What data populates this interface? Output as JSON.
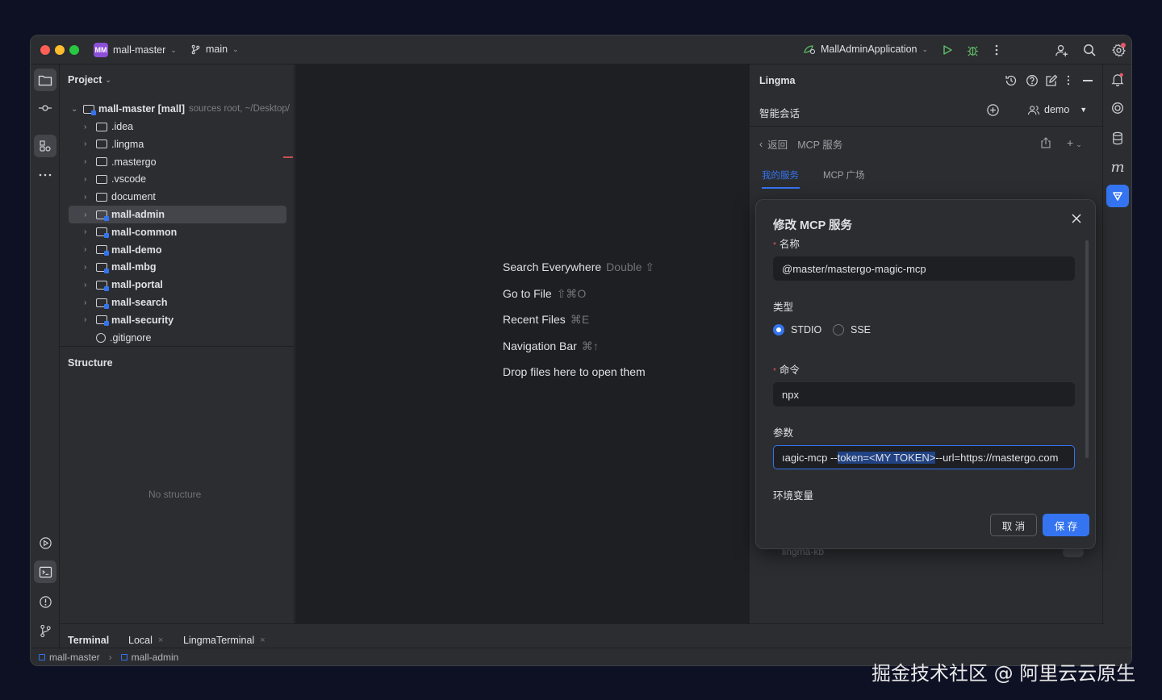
{
  "titlebar": {
    "project_badge": "MM",
    "project_name": "mall-master",
    "branch": "main",
    "run_config": "MallAdminApplication"
  },
  "project_panel": {
    "title": "Project",
    "root": {
      "name": "mall-master [mall]",
      "note": "sources root, ~/Desktop/"
    },
    "items": [
      {
        "label": ".idea",
        "bold": false
      },
      {
        "label": ".lingma",
        "bold": false
      },
      {
        "label": ".mastergo",
        "bold": false
      },
      {
        "label": ".vscode",
        "bold": false
      },
      {
        "label": "document",
        "bold": false
      },
      {
        "label": "mall-admin",
        "bold": true
      },
      {
        "label": "mall-common",
        "bold": true
      },
      {
        "label": "mall-demo",
        "bold": true
      },
      {
        "label": "mall-mbg",
        "bold": true
      },
      {
        "label": "mall-portal",
        "bold": true
      },
      {
        "label": "mall-search",
        "bold": true
      },
      {
        "label": "mall-security",
        "bold": true
      },
      {
        "label": ".gitignore",
        "bold": false
      }
    ]
  },
  "structure_panel": {
    "title": "Structure",
    "empty": "No structure"
  },
  "editor_hints": [
    {
      "label": "Search Everywhere",
      "key": "Double ⇧"
    },
    {
      "label": "Go to File",
      "key": "⇧⌘O"
    },
    {
      "label": "Recent Files",
      "key": "⌘E"
    },
    {
      "label": "Navigation Bar",
      "key": "⌘↑"
    },
    {
      "label": "Drop files here to open them",
      "key": ""
    }
  ],
  "lingma": {
    "title": "Lingma",
    "chat_label": "智能会话",
    "user": "demo",
    "back_label": "返回",
    "section": "MCP 服务",
    "tab_mine": "我的服务",
    "tab_plaza": "MCP 广场",
    "behind_item": "lingma-kb"
  },
  "modal": {
    "title": "修改 MCP 服务",
    "name_label": "名称",
    "name_value": "@master/mastergo-magic-mcp",
    "type_label": "类型",
    "type_opt1": "STDIO",
    "type_opt2": "SSE",
    "command_label": "命令",
    "command_value": "npx",
    "args_label": "参数",
    "args_before": "ıagic-mcp --",
    "args_selected": "token=<MY TOKEN>",
    "args_after": " --url=https://mastergo.com",
    "env_label": "环境变量",
    "cancel": "取 消",
    "save": "保 存"
  },
  "bottom_tabs": {
    "terminal": "Terminal",
    "local": "Local",
    "lingma_terminal": "LingmaTerminal"
  },
  "statusbar": {
    "crumb1": "mall-master",
    "crumb2": "mall-admin"
  },
  "watermark": "掘金技术社区 @ 阿里云云原生",
  "colors": {
    "accent": "#3574f0",
    "panel": "#2b2d30",
    "editor": "#1e1f22"
  }
}
